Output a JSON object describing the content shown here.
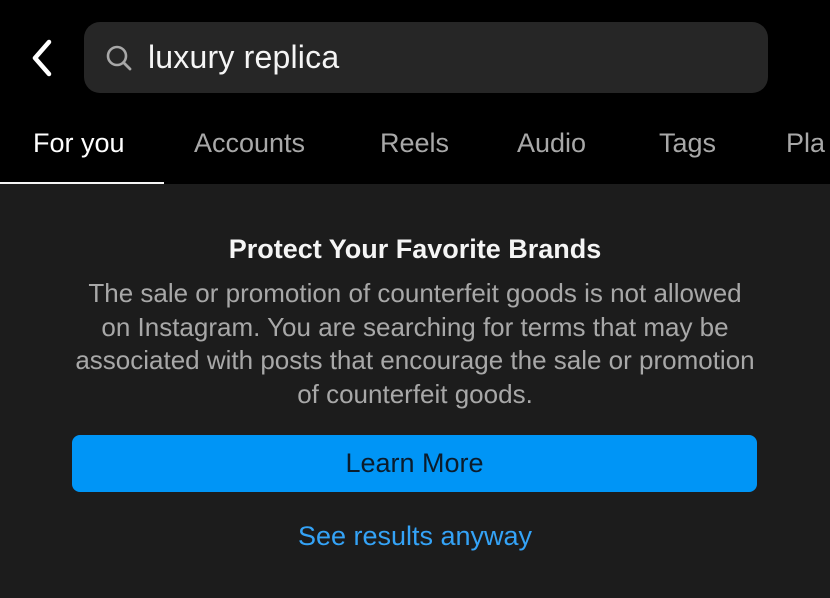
{
  "search": {
    "value": "luxury replica",
    "back_icon": "chevron-left-icon",
    "search_icon": "search-icon"
  },
  "tabs": [
    {
      "label": "For you",
      "active": true
    },
    {
      "label": "Accounts",
      "active": false
    },
    {
      "label": "Reels",
      "active": false
    },
    {
      "label": "Audio",
      "active": false
    },
    {
      "label": "Tags",
      "active": false
    },
    {
      "label": "Pla",
      "active": false
    }
  ],
  "notice": {
    "title": "Protect Your Favorite Brands",
    "body": "The sale or promotion of counterfeit goods is not allowed on Instagram. You are searching for terms that may be associated with posts that encourage the sale or promotion of counterfeit goods.",
    "primary_button_label": "Learn More",
    "secondary_link_label": "See results anyway"
  },
  "colors": {
    "background": "#000000",
    "panel": "#1c1c1c",
    "search_field": "#262626",
    "accent": "#0095f6",
    "link": "#34a3f7",
    "muted_text": "#a8a8a8"
  }
}
